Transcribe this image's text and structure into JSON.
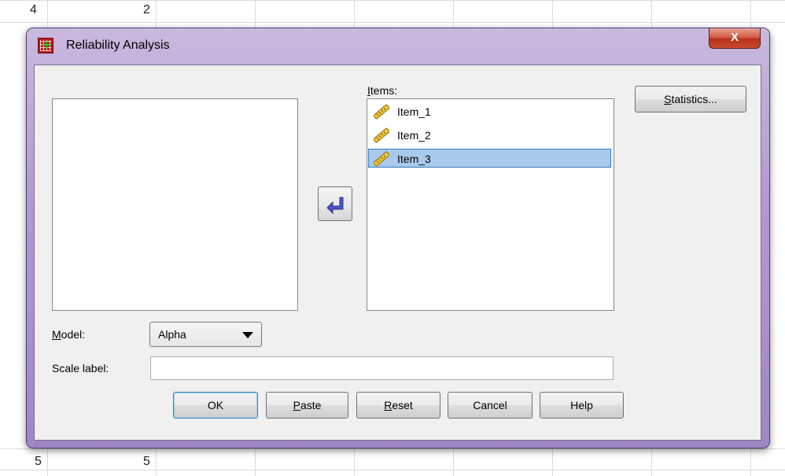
{
  "background": {
    "cells_top": [
      "4",
      "2"
    ],
    "cells_bottom": [
      "5",
      "5"
    ]
  },
  "window": {
    "title": "Reliability Analysis",
    "close_glyph": "X"
  },
  "items_label_first": "I",
  "items_label_rest": "tems:",
  "items": [
    {
      "label": "Item_1",
      "icon": "scale-ruler-icon"
    },
    {
      "label": "Item_2",
      "icon": "scale-ruler-icon"
    },
    {
      "label": "Item_3",
      "icon": "scale-ruler-icon",
      "selected": true
    }
  ],
  "statistics_button": {
    "mnemonic": "S",
    "rest": "tatistics..."
  },
  "move_button": {
    "icon": "move-left-arrow-icon"
  },
  "model": {
    "label_mnemonic": "M",
    "label_rest": "odel:",
    "value": "Alpha"
  },
  "scale_label": {
    "label": "Scale label:",
    "value": ""
  },
  "buttons": {
    "ok": "OK",
    "paste_mnemonic": "P",
    "paste_rest": "aste",
    "reset_mnemonic": "R",
    "reset_rest": "eset",
    "cancel": "Cancel",
    "help": "Help"
  },
  "colors": {
    "title_gradient_top": "#c9b9de",
    "title_gradient_bottom": "#9f86c6",
    "selection": "#a8cbec",
    "close_red": "#c9492f"
  }
}
